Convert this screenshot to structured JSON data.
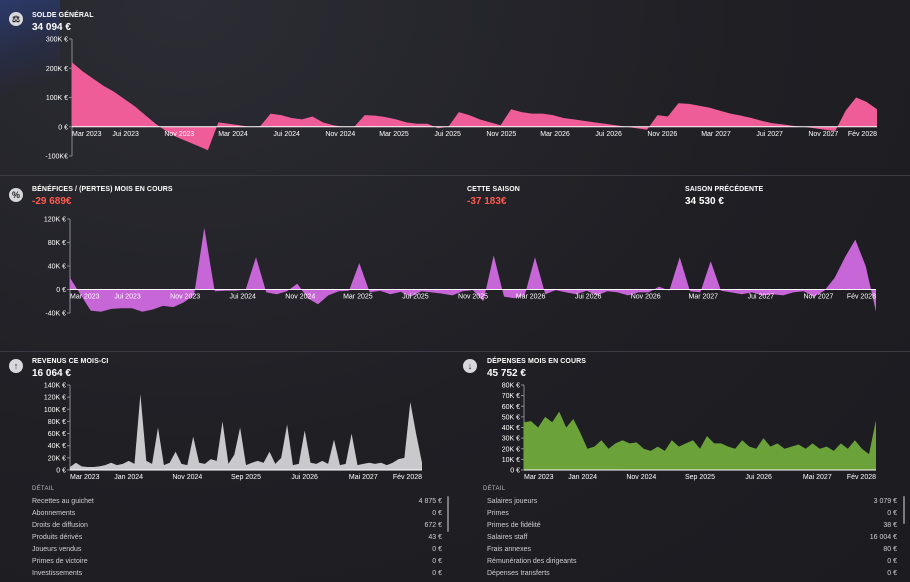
{
  "colors": {
    "balance": "#ef5d98",
    "profit": "#c766d6",
    "income": "#c9c9cc",
    "expenses": "#6ba23a",
    "negative_text": "#ff5a4e"
  },
  "balance": {
    "icon": "scale-icon",
    "label": "SOLDE GÉNÉRAL",
    "value": "34 094 €"
  },
  "profit": {
    "icon": "percent-icon",
    "label": "BÉNÉFICES / (PERTES) MOIS EN COURS",
    "value": "-29 689€",
    "season_label": "CETTE SAISON",
    "season_value": "-37 183€",
    "prev_label": "SAISON PRÉCÉDENTE",
    "prev_value": "34 530 €"
  },
  "income": {
    "icon": "arrow-up-icon",
    "label": "REVENUS CE MOIS-CI",
    "value": "16 064 €",
    "detail_title": "DÉTAIL",
    "rows": [
      {
        "name": "Recettes au guichet",
        "amount": "4 875 €"
      },
      {
        "name": "Abonnements",
        "amount": "0 €"
      },
      {
        "name": "Droits de diffusion",
        "amount": "672 €"
      },
      {
        "name": "Produits dérivés",
        "amount": "43 €"
      },
      {
        "name": "Joueurs vendus",
        "amount": "0 €"
      },
      {
        "name": "Primes de victoire",
        "amount": "0 €"
      },
      {
        "name": "Investissements",
        "amount": "0 €"
      }
    ]
  },
  "expenses": {
    "icon": "arrow-down-icon",
    "label": "DÉPENSES MOIS EN COURS",
    "value": "45 752 €",
    "detail_title": "DÉTAIL",
    "rows": [
      {
        "name": "Salaires joueurs",
        "amount": "3 079 €"
      },
      {
        "name": "Primes",
        "amount": "0 €"
      },
      {
        "name": "Primes de fidélité",
        "amount": "38 €"
      },
      {
        "name": "Salaires staff",
        "amount": "16 004 €"
      },
      {
        "name": "Frais annexes",
        "amount": "80 €"
      },
      {
        "name": "Rémunération des dirigeants",
        "amount": "0 €"
      },
      {
        "name": "Dépenses transferts",
        "amount": "0 €"
      }
    ]
  },
  "chart_data": [
    {
      "type": "area",
      "id": "balance",
      "y_ticks": [
        -100000,
        0,
        100000,
        200000,
        300000
      ],
      "y_tick_labels": [
        "-100K€",
        "0 €",
        "100K €",
        "200K €",
        "300K €"
      ],
      "ylim": [
        -100000,
        300000
      ],
      "x_labels": [
        "Mar 2023",
        "Jui 2023",
        "Nov 2023",
        "Mar 2024",
        "Jui 2024",
        "Nov 2024",
        "Mar 2025",
        "Jui 2025",
        "Nov 2025",
        "Mar 2026",
        "Jui 2026",
        "Nov 2026",
        "Mar 2027",
        "Jui 2027",
        "Nov 2027",
        "Fév 2028"
      ],
      "values": [
        220000,
        190000,
        165000,
        140000,
        120000,
        95000,
        70000,
        40000,
        10000,
        -15000,
        -35000,
        -50000,
        -65000,
        -80000,
        15000,
        10000,
        5000,
        0,
        2000,
        45000,
        40000,
        30000,
        25000,
        35000,
        15000,
        5000,
        0,
        0,
        40000,
        38000,
        33000,
        25000,
        15000,
        10000,
        10000,
        -5000,
        0,
        50000,
        40000,
        25000,
        15000,
        5000,
        60000,
        50000,
        45000,
        45000,
        40000,
        30000,
        25000,
        20000,
        15000,
        10000,
        5000,
        0,
        -5000,
        -10000,
        40000,
        35000,
        80000,
        78000,
        72000,
        65000,
        55000,
        45000,
        38000,
        30000,
        20000,
        12000,
        8000,
        3000,
        0,
        -5000,
        -10000,
        -15000,
        55000,
        100000,
        85000,
        60000
      ]
    },
    {
      "type": "area",
      "id": "profit",
      "y_ticks": [
        -40000,
        0,
        40000,
        80000,
        120000
      ],
      "y_tick_labels": [
        "-40K €",
        "0 €",
        "40K €",
        "80K €",
        "120K €"
      ],
      "ylim": [
        -40000,
        120000
      ],
      "x_labels": [
        "Mar 2023",
        "Jui 2023",
        "Nov 2023",
        "Jui 2024",
        "Nov 2024",
        "Mar 2025",
        "Jui 2025",
        "Nov 2025",
        "Mar 2026",
        "Jui 2026",
        "Nov 2026",
        "Mar 2027",
        "Jui 2027",
        "Nov 2027",
        "Fév 2028"
      ],
      "values": [
        20000,
        -8000,
        -36000,
        -38000,
        -33000,
        -32000,
        -32000,
        -38000,
        -34000,
        -28000,
        -30000,
        -22000,
        -10000,
        105000,
        -3000,
        -2000,
        -2000,
        0,
        55000,
        -5000,
        -8000,
        -3000,
        10000,
        -15000,
        -25000,
        -10000,
        -3000,
        -2000,
        45000,
        -5000,
        -2000,
        -8000,
        -4000,
        -12000,
        -3000,
        -5000,
        -7000,
        -10000,
        -3000,
        -1000,
        -20000,
        58000,
        -12000,
        -15000,
        -10000,
        55000,
        -8000,
        -1000,
        -5000,
        -8000,
        -2000,
        -10000,
        -3000,
        -5000,
        -10000,
        -5000,
        -5000,
        5000,
        -2000,
        55000,
        -3000,
        -5000,
        48000,
        -2000,
        -5000,
        -8000,
        -5000,
        -10000,
        -8000,
        -10000,
        -5000,
        -3000,
        -12000,
        -2000,
        20000,
        55000,
        85000,
        40000,
        -38000
      ]
    },
    {
      "type": "area",
      "id": "income",
      "y_ticks": [
        0,
        20000,
        40000,
        60000,
        80000,
        100000,
        120000,
        140000
      ],
      "y_tick_labels": [
        "0 €",
        "20K €",
        "40K €",
        "60K €",
        "80K €",
        "100K €",
        "120K €",
        "140K €"
      ],
      "ylim": [
        0,
        140000
      ],
      "x_labels": [
        "Mar 2023",
        "Jan 2024",
        "Nov 2024",
        "Sep 2025",
        "Jui 2026",
        "Mai 2027",
        "Fév 2028"
      ],
      "values": [
        5000,
        12000,
        6000,
        5000,
        5000,
        6000,
        8000,
        12000,
        8000,
        10000,
        15000,
        10000,
        125000,
        15000,
        10000,
        70000,
        8000,
        12000,
        30000,
        10000,
        8000,
        55000,
        12000,
        10000,
        18000,
        15000,
        80000,
        10000,
        25000,
        70000,
        8000,
        12000,
        15000,
        12000,
        30000,
        10000,
        20000,
        75000,
        8000,
        10000,
        65000,
        12000,
        10000,
        15000,
        10000,
        50000,
        8000,
        10000,
        60000,
        8000,
        10000,
        12000,
        10000,
        12000,
        8000,
        12000,
        18000,
        20000,
        112000,
        60000,
        12000
      ]
    },
    {
      "type": "area",
      "id": "expenses",
      "y_ticks": [
        0,
        10000,
        20000,
        30000,
        40000,
        50000,
        60000,
        70000,
        80000
      ],
      "y_tick_labels": [
        "0 €",
        "10K €",
        "20K €",
        "30K €",
        "40K €",
        "50K €",
        "60K €",
        "70K €",
        "80K €"
      ],
      "ylim": [
        0,
        80000
      ],
      "x_labels": [
        "Mar 2023",
        "Jan 2024",
        "Nov 2024",
        "Sep 2025",
        "Jui 2026",
        "Mai 2027",
        "Fév 2028"
      ],
      "values": [
        45000,
        46000,
        40000,
        50000,
        45000,
        55000,
        40000,
        48000,
        35000,
        20000,
        22000,
        28000,
        20000,
        25000,
        28000,
        25000,
        26000,
        20000,
        18000,
        22000,
        18000,
        28000,
        22000,
        25000,
        28000,
        20000,
        32000,
        25000,
        25000,
        22000,
        20000,
        28000,
        22000,
        20000,
        30000,
        22000,
        25000,
        20000,
        22000,
        24000,
        20000,
        25000,
        20000,
        22000,
        18000,
        25000,
        20000,
        28000,
        20000,
        15000,
        47000
      ]
    }
  ]
}
